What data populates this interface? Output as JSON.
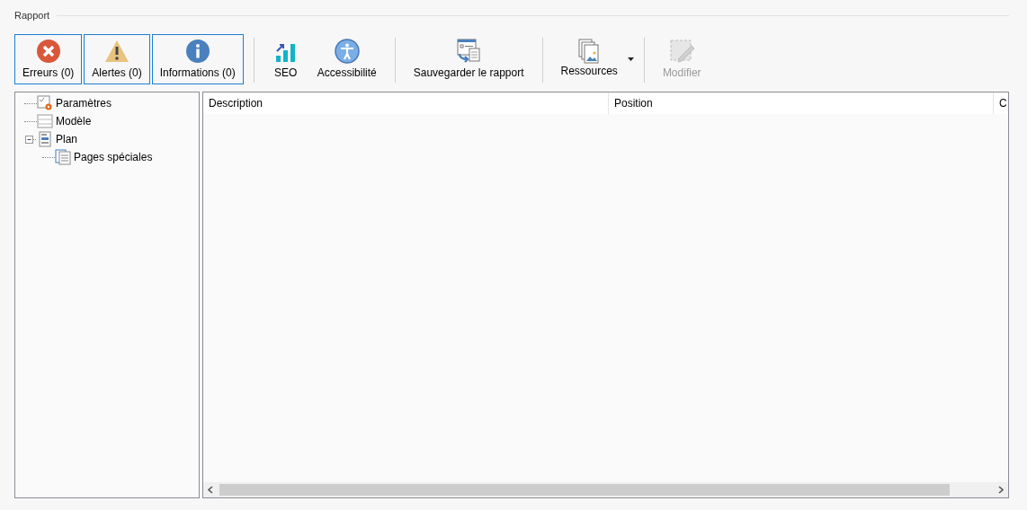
{
  "group_title": "Rapport",
  "toolbar": [
    {
      "kind": "toggle",
      "label": "Erreurs (0)",
      "selected": true
    },
    {
      "kind": "toggle",
      "label": "Alertes (0)",
      "selected": true
    },
    {
      "kind": "toggle",
      "label": "Informations (0)",
      "selected": true
    },
    {
      "kind": "separator"
    },
    {
      "kind": "button",
      "label": "SEO",
      "disabled": false
    },
    {
      "kind": "button",
      "label": "Accessibilité",
      "disabled": false
    },
    {
      "kind": "separator"
    },
    {
      "kind": "button",
      "label": "Sauvegarder le rapport",
      "disabled": false
    },
    {
      "kind": "separator"
    },
    {
      "kind": "dropdown",
      "label": "Ressources",
      "disabled": false
    },
    {
      "kind": "separator"
    },
    {
      "kind": "button",
      "label": "Modifier",
      "disabled": true
    }
  ],
  "tree": [
    {
      "label": "Paramètres"
    },
    {
      "label": "Modèle"
    },
    {
      "label": "Plan",
      "expanded": true,
      "children": [
        {
          "label": "Pages spéciales"
        }
      ]
    }
  ],
  "table": {
    "columns": [
      "Description",
      "Position",
      "C"
    ]
  }
}
